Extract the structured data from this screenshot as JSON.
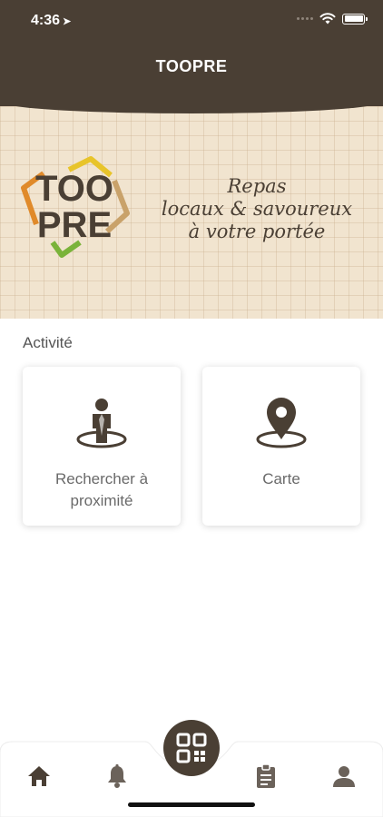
{
  "status_bar": {
    "time": "4:36",
    "location_arrow": "➤"
  },
  "header": {
    "title": "TOOPRE"
  },
  "banner": {
    "logo_text": [
      "TOO",
      "PRE"
    ],
    "tagline": [
      "Repas",
      "locaux & savoureux",
      "à votre portée"
    ]
  },
  "activity": {
    "section_label": "Activité",
    "cards": [
      {
        "label": "Rechercher à proximité",
        "icon": "person-location-icon"
      },
      {
        "label": "Carte",
        "icon": "map-pin-icon"
      }
    ]
  },
  "bottom_nav": {
    "items": [
      {
        "icon": "home-icon",
        "active": true
      },
      {
        "icon": "bell-icon",
        "active": false
      },
      {
        "icon": "qr-code-icon",
        "active": false
      },
      {
        "icon": "clipboard-icon",
        "active": false
      },
      {
        "icon": "profile-icon",
        "active": false
      }
    ]
  },
  "colors": {
    "brand_brown": "#4a3f34",
    "banner_bg": "#f1e4cf",
    "logo_orange": "#e08a2a",
    "logo_yellow": "#e8c42a",
    "logo_green": "#7ab33a",
    "logo_tan": "#c9a26a"
  }
}
